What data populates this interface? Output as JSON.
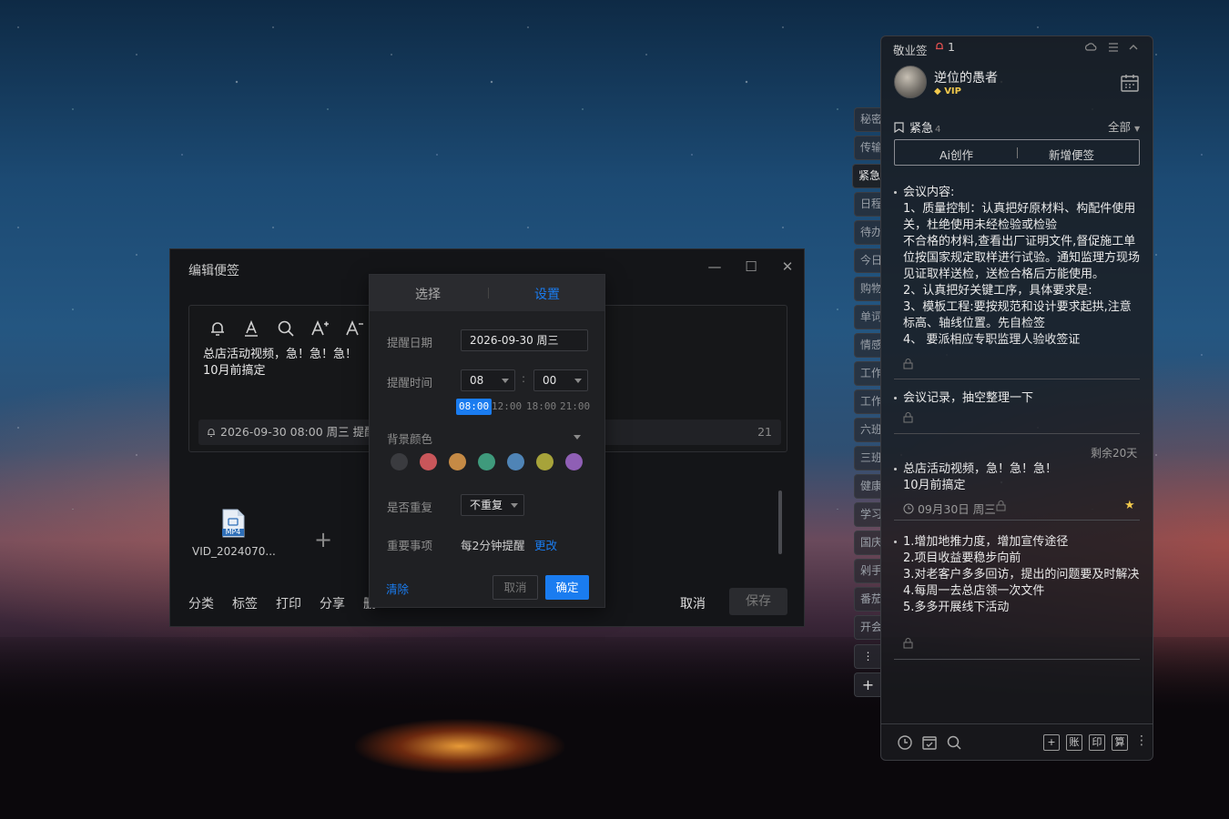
{
  "edit_window": {
    "title": "编辑便签",
    "controls": {
      "minimize": "—",
      "maximize": "☐",
      "close": "✕"
    },
    "content_lines": [
      "总店活动视频，急！急！急！",
      "10月前搞定"
    ],
    "reminder_chip": "2026-09-30 08:00 周三 提醒",
    "char_count": "21",
    "attachment": {
      "badge": "MP4",
      "name": "VID_2024070..."
    },
    "footer": [
      "分类",
      "标签",
      "打印",
      "分享"
    ],
    "footer_cut": "删",
    "cancel_label": "取消",
    "save_label": "保存"
  },
  "reminder_popup": {
    "tabs": [
      "选择",
      "设置"
    ],
    "active_tab": "设置",
    "date_label": "提醒日期",
    "date_value": "2026-09-30  周三",
    "time_label": "提醒时间",
    "hour": "08",
    "minute": "00",
    "time_sep": ":",
    "quick_times": [
      "08:00",
      "12:00",
      "18:00",
      "21:00"
    ],
    "bg_label": "背景颜色",
    "colors": [
      "#3a3b3f",
      "#c9565a",
      "#c58a45",
      "#3f9a7c",
      "#4f84b6",
      "#a7a33a",
      "#8f5fb5"
    ],
    "repeat_label": "是否重复",
    "repeat_value": "不重复",
    "important_label": "重要事项",
    "important_value": "每2分钟提醒",
    "change_label": "更改",
    "clear_label": "清除",
    "cancel_label": "取消",
    "confirm_label": "确定",
    "accent": "#1a7cf0"
  },
  "side_tabs": [
    "秘密",
    "传输",
    "紧急",
    "日程",
    "待办",
    "今日",
    "购物",
    "单词",
    "情感",
    "工作",
    "工作",
    "六班",
    "三班",
    "健康",
    "学习",
    "国庆",
    "剁手",
    "番茄",
    "开会"
  ],
  "side_tab_active": "紧急",
  "side_actions": {
    "more": "⋮",
    "add": "+"
  },
  "app": {
    "name": "敬业签",
    "alarm_count": "1",
    "user": {
      "name": "逆位的愚者",
      "badge": "VIP"
    },
    "folder": {
      "name": "紧急",
      "count": "4"
    },
    "filter": "全部",
    "actions": [
      "Ai创作",
      "新增便签"
    ],
    "notes": [
      {
        "text": "会议内容:\n1、质量控制：认真把好原材料、构配件使用关，杜绝使用未经检验或检验\n不合格的材料,查看出厂证明文件,督促施工单位按国家规定取样进行试验。通知监理方现场见证取样送检，送检合格后方能使用。\n2、认真把好关键工序，具体要求是:\n3、模板工程:要按规范和设计要求起拱,注意标高、轴线位置。先自检签\n4、 要派相应专职监理人验收签证"
      },
      {
        "text": "会议记录，抽空整理一下"
      },
      {
        "text": "总店活动视频，急！急！急！\n10月前搞定",
        "remaining": "剩余20天",
        "due": "09月30日 周三"
      },
      {
        "text": "1.增加地推力度，增加宣传途径\n2.项目收益要稳步向前\n3.对老客户多多回访，提出的问题要及时解决\n4.每周一去总店领一次文件\n5.多多开展线下活动"
      }
    ],
    "bottom_boxes": [
      "+",
      "账",
      "印",
      "算"
    ],
    "bottom_more": "⋮"
  }
}
